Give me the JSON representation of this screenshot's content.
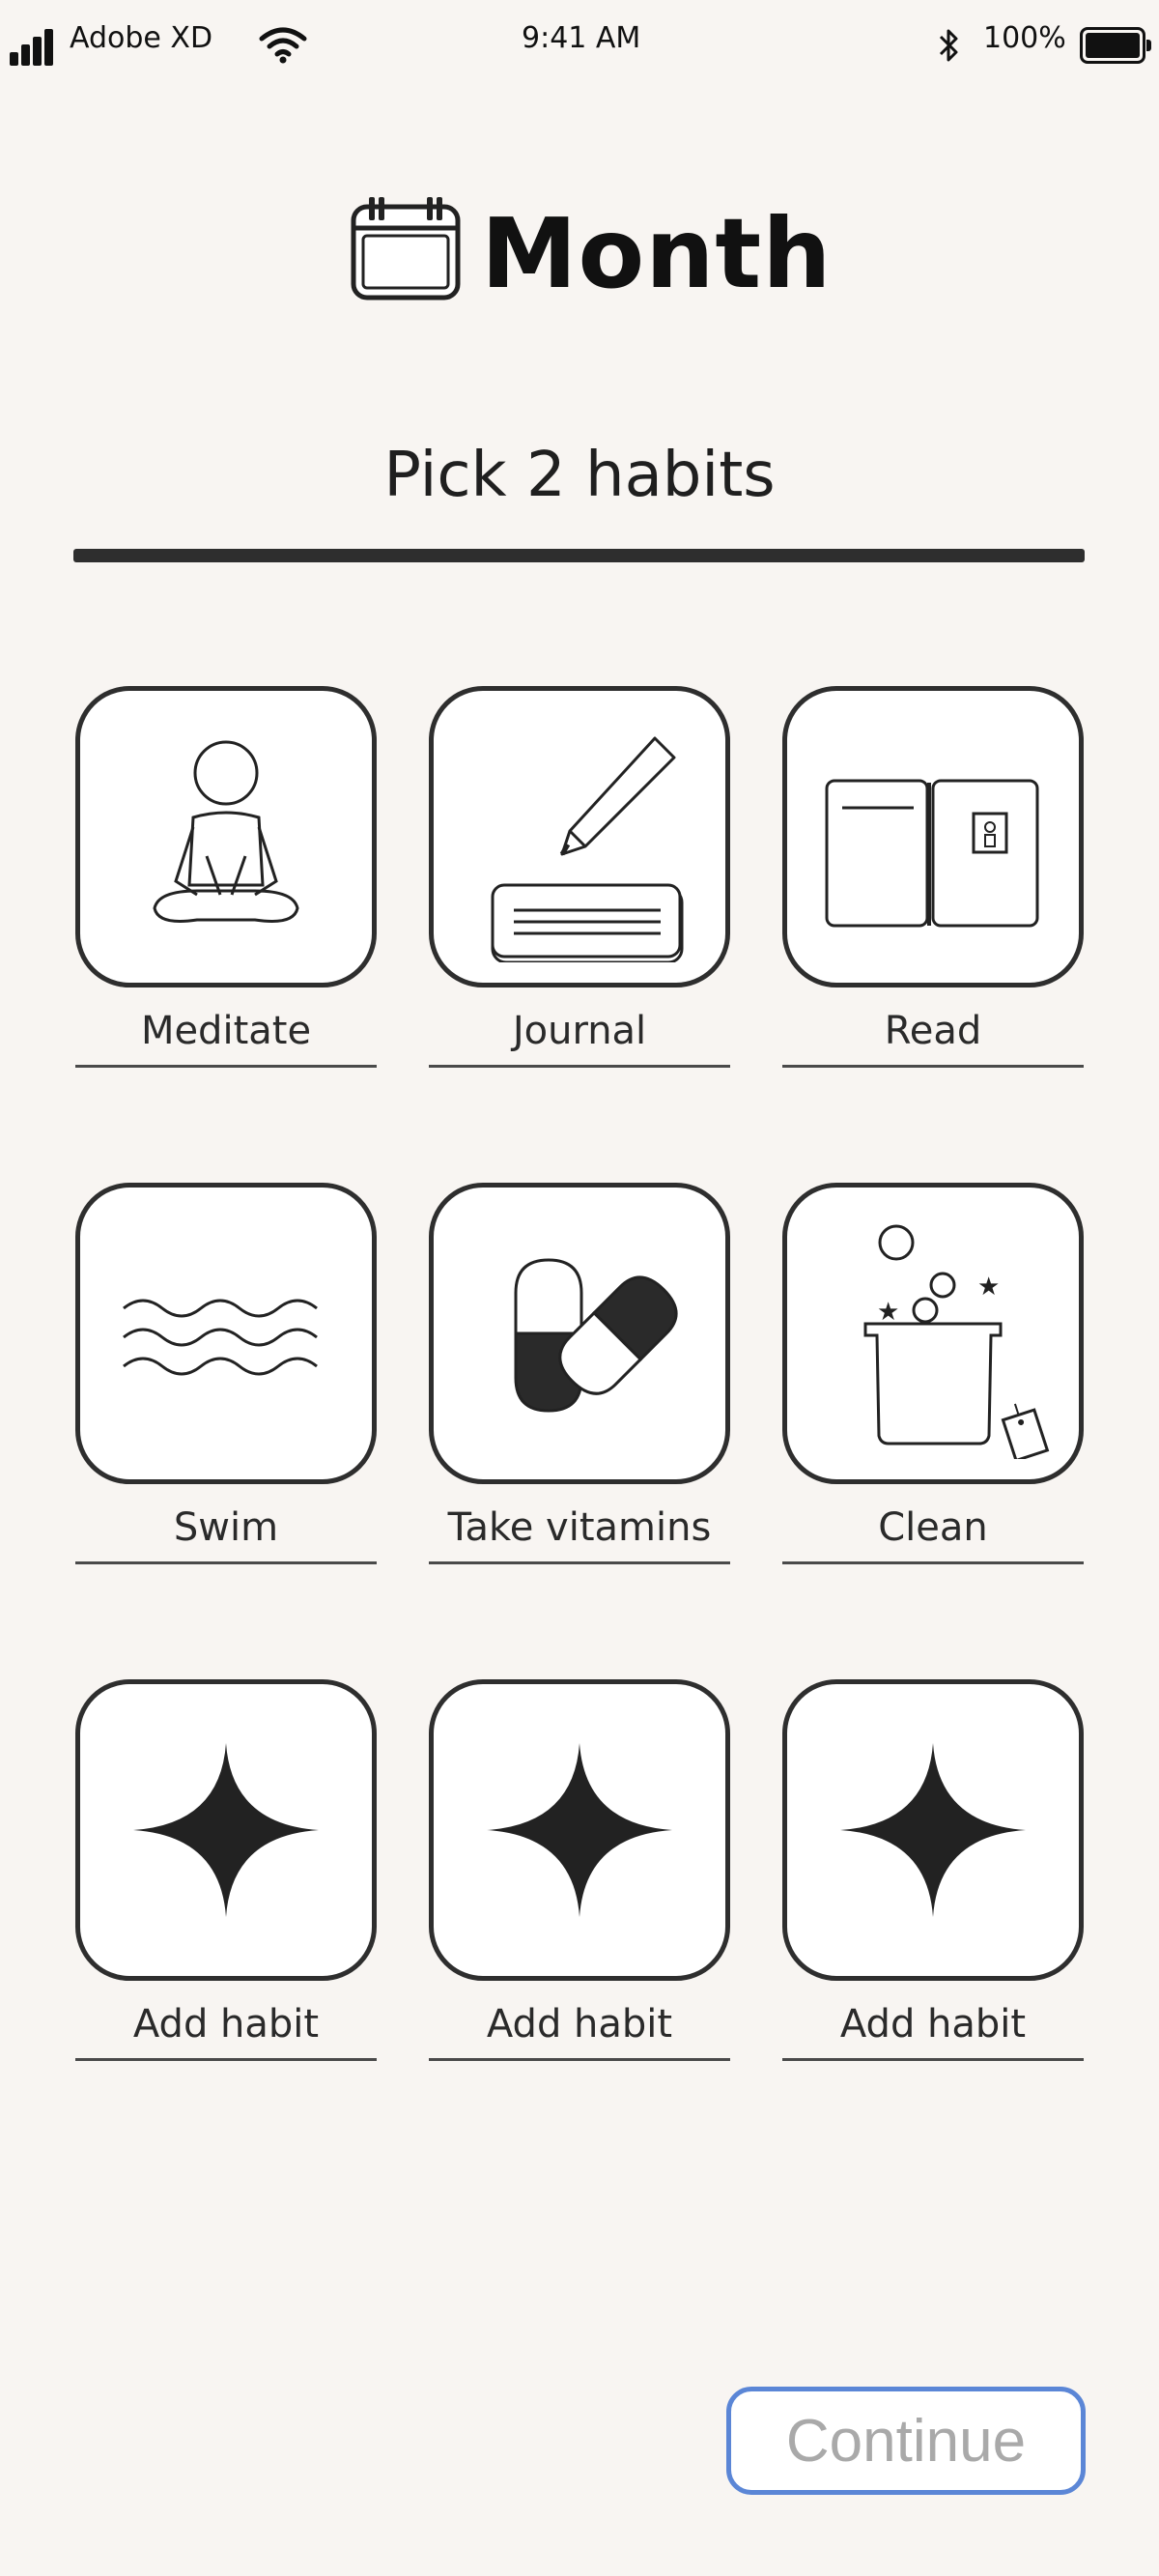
{
  "status_bar": {
    "carrier": "Adobe XD",
    "time": "9:41 AM",
    "battery_percent": "100%"
  },
  "header": {
    "title": "Month",
    "icon": "calendar-icon"
  },
  "subtitle": "Pick 2 habits",
  "progress": {
    "fraction": 1.0
  },
  "habits": [
    {
      "label": "Meditate",
      "icon": "meditate-icon"
    },
    {
      "label": "Journal",
      "icon": "journal-icon"
    },
    {
      "label": "Read",
      "icon": "book-icon"
    },
    {
      "label": "Swim",
      "icon": "waves-icon"
    },
    {
      "label": "Take vitamins",
      "icon": "pill-icon"
    },
    {
      "label": "Clean",
      "icon": "cleaning-icon"
    },
    {
      "label": "Add habit",
      "icon": "sparkle-icon"
    },
    {
      "label": "Add habit",
      "icon": "sparkle-icon"
    },
    {
      "label": "Add habit",
      "icon": "sparkle-icon"
    }
  ],
  "continue_label": "Continue",
  "colors": {
    "background": "#f8f5f2",
    "tile_border": "#2e2e2e",
    "button_border": "#5b86d6",
    "button_text": "#a9a9a9"
  }
}
